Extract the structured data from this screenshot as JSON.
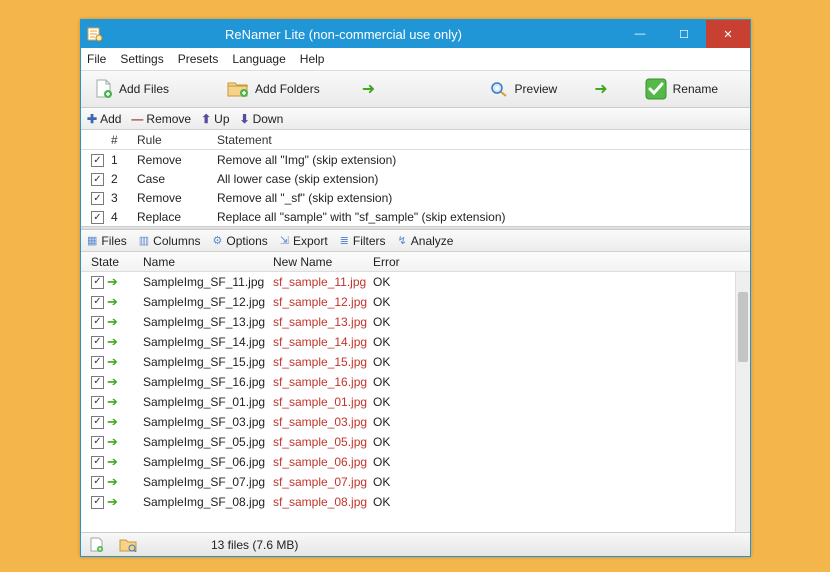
{
  "window": {
    "title": "ReNamer Lite (non-commercial use only)"
  },
  "menu": [
    "File",
    "Settings",
    "Presets",
    "Language",
    "Help"
  ],
  "toolbar": {
    "add_files": "Add Files",
    "add_folders": "Add Folders",
    "preview": "Preview",
    "rename": "Rename"
  },
  "rulestrip": {
    "add": "Add",
    "remove": "Remove",
    "up": "Up",
    "down": "Down"
  },
  "rules_header": {
    "num": "#",
    "rule": "Rule",
    "statement": "Statement"
  },
  "rules": [
    {
      "n": "1",
      "rule": "Remove",
      "stmt": "Remove all \"Img\" (skip extension)"
    },
    {
      "n": "2",
      "rule": "Case",
      "stmt": "All lower case (skip extension)"
    },
    {
      "n": "3",
      "rule": "Remove",
      "stmt": "Remove all \"_sf\" (skip extension)"
    },
    {
      "n": "4",
      "rule": "Replace",
      "stmt": "Replace all \"sample\" with \"sf_sample\" (skip extension)"
    }
  ],
  "filestrip": {
    "files": "Files",
    "columns": "Columns",
    "options": "Options",
    "export": "Export",
    "filters": "Filters",
    "analyze": "Analyze"
  },
  "files_header": {
    "state": "State",
    "name": "Name",
    "new": "New Name",
    "error": "Error"
  },
  "files": [
    {
      "name": "SampleImg_SF_11.jpg",
      "new": "sf_sample_11.jpg",
      "err": "OK"
    },
    {
      "name": "SampleImg_SF_12.jpg",
      "new": "sf_sample_12.jpg",
      "err": "OK"
    },
    {
      "name": "SampleImg_SF_13.jpg",
      "new": "sf_sample_13.jpg",
      "err": "OK"
    },
    {
      "name": "SampleImg_SF_14.jpg",
      "new": "sf_sample_14.jpg",
      "err": "OK"
    },
    {
      "name": "SampleImg_SF_15.jpg",
      "new": "sf_sample_15.jpg",
      "err": "OK"
    },
    {
      "name": "SampleImg_SF_16.jpg",
      "new": "sf_sample_16.jpg",
      "err": "OK"
    },
    {
      "name": "SampleImg_SF_01.jpg",
      "new": "sf_sample_01.jpg",
      "err": "OK"
    },
    {
      "name": "SampleImg_SF_03.jpg",
      "new": "sf_sample_03.jpg",
      "err": "OK"
    },
    {
      "name": "SampleImg_SF_05.jpg",
      "new": "sf_sample_05.jpg",
      "err": "OK"
    },
    {
      "name": "SampleImg_SF_06.jpg",
      "new": "sf_sample_06.jpg",
      "err": "OK"
    },
    {
      "name": "SampleImg_SF_07.jpg",
      "new": "sf_sample_07.jpg",
      "err": "OK"
    },
    {
      "name": "SampleImg_SF_08.jpg",
      "new": "sf_sample_08.jpg",
      "err": "OK"
    }
  ],
  "status": {
    "text": "13 files (7.6 MB)"
  }
}
